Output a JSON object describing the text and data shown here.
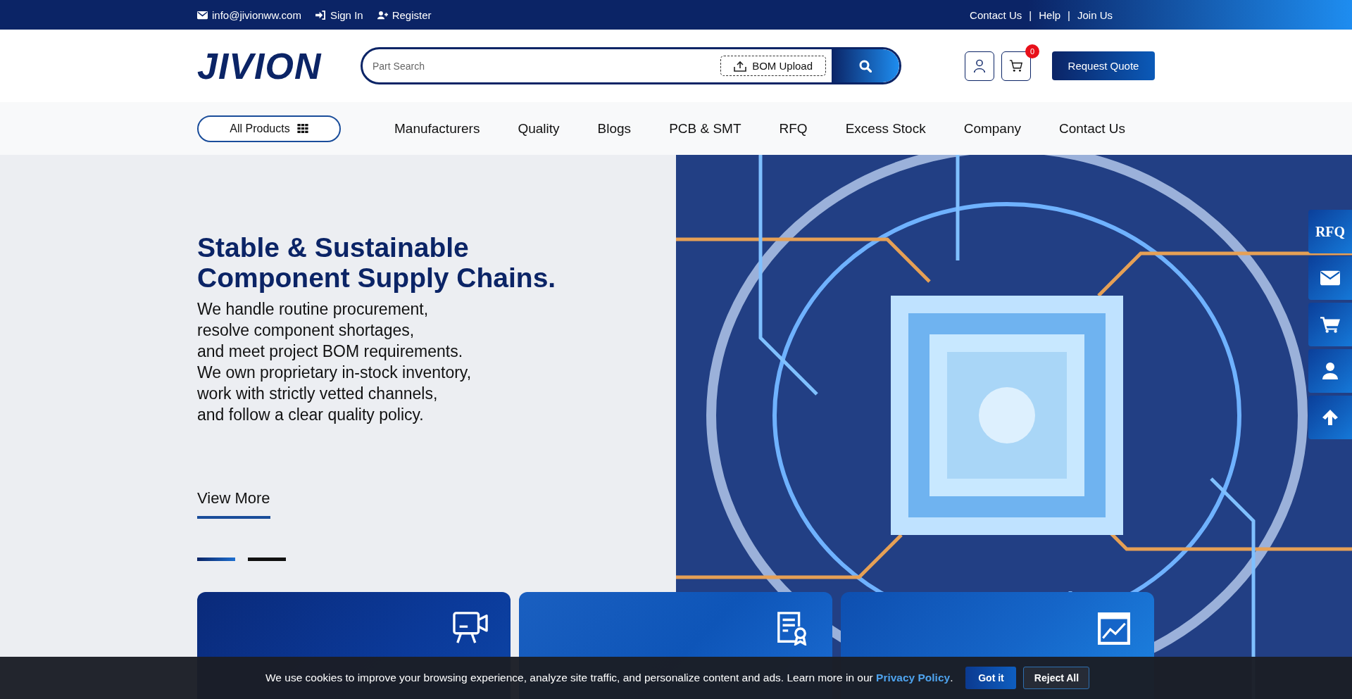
{
  "top_bar": {
    "email": "info@jivionww.com",
    "links": [
      {
        "kind": "signin",
        "label": "Sign In"
      },
      {
        "kind": "register",
        "label": "Register"
      }
    ],
    "right_links": [
      "Contact Us",
      "Help",
      "Join Us"
    ],
    "separator": "|"
  },
  "header": {
    "logo": "JIVION",
    "search": {
      "placeholder": "Part Search"
    },
    "bom_button": "BOM Upload",
    "cart_count": "0",
    "request_quote": "Request Quote"
  },
  "nav": {
    "all_products": "All Products",
    "items": [
      "Manufacturers",
      "Quality",
      "Blogs",
      "PCB & SMT",
      "RFQ",
      "Excess Stock",
      "Company",
      "Contact Us"
    ]
  },
  "hero": {
    "title_lines": [
      "Stable & Sustainable",
      "Component Supply Chains."
    ],
    "text_lines": [
      "We handle routine procurement,",
      "resolve component shortages,",
      "and meet project BOM requirements.",
      "We own proprietary in-stock inventory,",
      "work with strictly vetted channels,",
      "and follow a clear quality policy."
    ],
    "view_more": "View More",
    "slides": [
      {
        "selected": true
      },
      {
        "selected": false
      }
    ]
  },
  "feature_cards": [
    {
      "kind": "video"
    },
    {
      "kind": "certificate"
    },
    {
      "kind": "chart"
    }
  ],
  "side_buttons": [
    {
      "kind": "rfq",
      "label": "RFQ"
    },
    {
      "kind": "mail"
    },
    {
      "kind": "cart"
    },
    {
      "kind": "user"
    },
    {
      "kind": "top"
    }
  ],
  "cookie_bar": {
    "text": "We use cookies to improve your browsing experience, analyze site traffic, and personalize content and ads. Learn more in our",
    "link": "Privacy Policy",
    "end": ".",
    "accept": "Got it",
    "reject": "Reject All"
  }
}
